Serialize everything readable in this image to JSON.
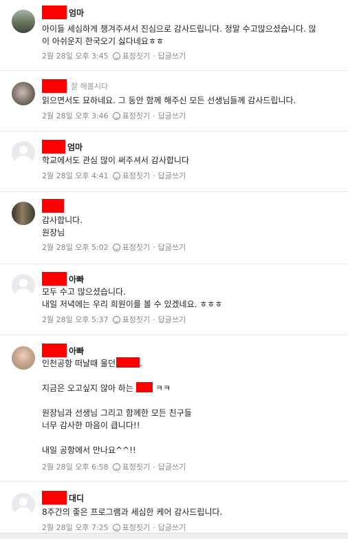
{
  "comments": [
    {
      "role": "엄마",
      "lines": [
        "아이들 세심하게 챙겨주셔서 진심으로 감사드립니다. 정말 수고많으셨습니다. 많",
        "이 아쉬운지 한국오기 싫다네요ㅎㅎ"
      ],
      "time": "2월 28일 오후 3:45"
    },
    {
      "role": "잘 해봅시다",
      "lines": [
        "읽으면서도 묘하네요. 그 동안 함께 해주신 모든 선생님들께 감사드립니다."
      ],
      "time": "2월 28일 오후 3:46"
    },
    {
      "role": "엄마",
      "lines": [
        "학교에서도 관심 많이 써주셔서 감사합니다"
      ],
      "time": "2월 28일 오후 4:41"
    },
    {
      "role": "",
      "lines": [
        "감사합니다.",
        "원장님"
      ],
      "time": "2월 28일 오후 5:02"
    },
    {
      "role": "아빠",
      "lines": [
        "모두 수고 많으셨습니다.",
        "내일 저녁에는 우리 희원이를 볼 수 있겠네요. ㅎㅎㅎ"
      ],
      "time": "2월 28일 오후 5:37"
    },
    {
      "role": "아빠",
      "line1_prefix": "인천공항 떠날때 울던",
      "line1_suffix": ".",
      "line2_prefix": "지금은 오고싶지 않아 하는",
      "line2_suffix": "ㅋㅋ",
      "line3": "원장님과 선생님 그리고 함께한 모든 친구들",
      "line4": "너무 감사한 마음이 큽니다!!",
      "line5": "내일 공항에서 만나요^^!!",
      "time": "2월 28일 오후 6:58"
    },
    {
      "role": "대디",
      "lines": [
        "8주간의 좋은 프로그램과 세심한 케어 감사드립니다."
      ],
      "time": "2월 28일 오후 7:25"
    }
  ],
  "actions": {
    "react": "표정짓기",
    "reply": "답글쓰기",
    "separator": "·"
  },
  "icons": {
    "avatar": "avatar",
    "react": "smile-icon"
  },
  "colors": {
    "redaction": "#ff0000",
    "meta": "#888888"
  }
}
